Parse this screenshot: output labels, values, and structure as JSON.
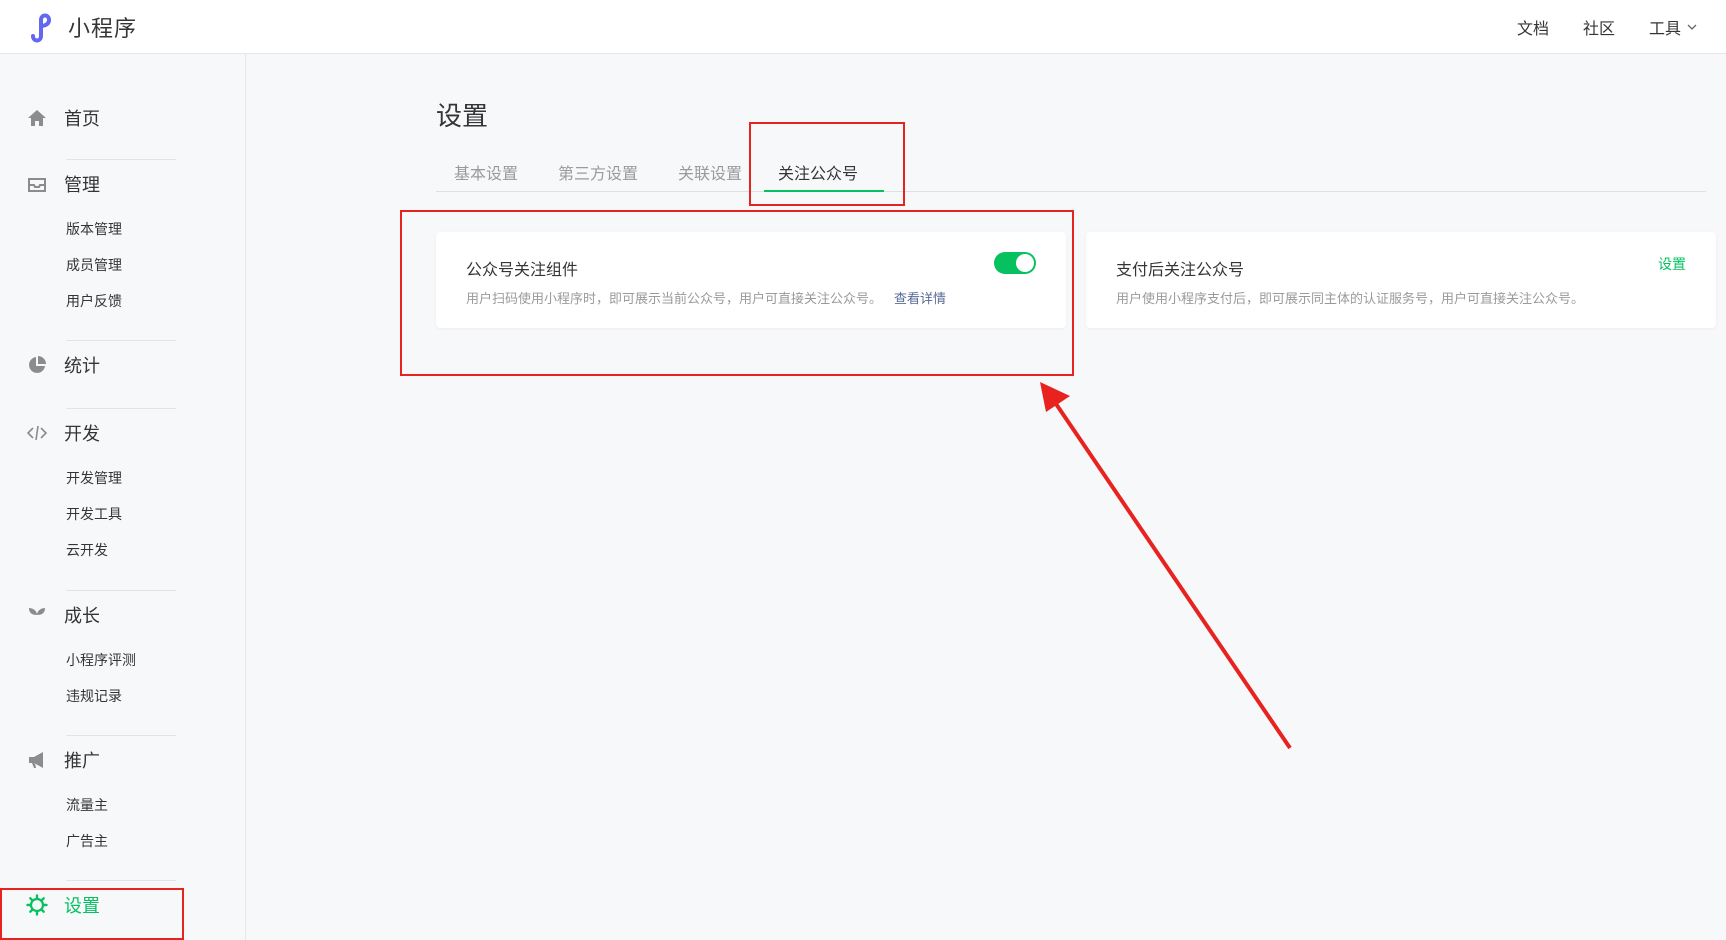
{
  "header": {
    "logo_text": "小程序",
    "nav": {
      "docs": "文档",
      "community": "社区",
      "tools": "工具"
    }
  },
  "sidebar": {
    "home": "首页",
    "manage": {
      "label": "管理",
      "items": [
        "版本管理",
        "成员管理",
        "用户反馈"
      ]
    },
    "stats": "统计",
    "develop": {
      "label": "开发",
      "items": [
        "开发管理",
        "开发工具",
        "云开发"
      ]
    },
    "growth": {
      "label": "成长",
      "items": [
        "小程序评测",
        "违规记录"
      ]
    },
    "promote": {
      "label": "推广",
      "items": [
        "流量主",
        "广告主"
      ]
    },
    "settings": "设置"
  },
  "main": {
    "title": "设置",
    "tabs": [
      "基本设置",
      "第三方设置",
      "关联设置",
      "关注公众号"
    ],
    "active_tab": 3,
    "cards": [
      {
        "title": "公众号关注组件",
        "desc": "用户扫码使用小程序时，即可展示当前公众号，用户可直接关注公众号。",
        "link": "查看详情",
        "toggle_on": true
      },
      {
        "title": "支付后关注公众号",
        "desc": "用户使用小程序支付后，即可展示同主体的认证服务号，用户可直接关注公众号。",
        "action": "设置"
      }
    ]
  },
  "colors": {
    "accent": "#07c160",
    "link": "#576b95",
    "annotation": "#e8231f",
    "logo": "#6467f0"
  }
}
